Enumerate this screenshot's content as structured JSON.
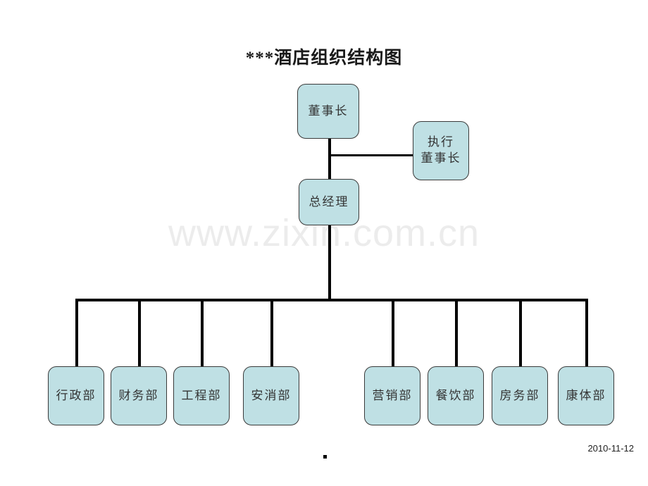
{
  "document": {
    "title": "***酒店组织结构图",
    "watermark": "www.zixin.com.cn",
    "date": "2010-11-12",
    "footer_marker": "."
  },
  "colors": {
    "node_fill": "#bfe0e4",
    "node_border": "#3a3a3a",
    "line": "#000000",
    "title_text": "#1a1a1a",
    "node_text": "#333333",
    "watermark_text": "#ececec",
    "page_background": "#ffffff"
  },
  "org_chart": {
    "type": "org-chart",
    "chairman": {
      "label": "董事长"
    },
    "executive_chairman": {
      "label_line1": "执行",
      "label_line2": "董事长"
    },
    "general_manager": {
      "label": "总经理"
    },
    "departments": [
      {
        "label": "行政部"
      },
      {
        "label": "财务部"
      },
      {
        "label": "工程部"
      },
      {
        "label": "安消部"
      },
      {
        "label": "营销部"
      },
      {
        "label": "餐饮部"
      },
      {
        "label": "房务部"
      },
      {
        "label": "康体部"
      }
    ]
  }
}
